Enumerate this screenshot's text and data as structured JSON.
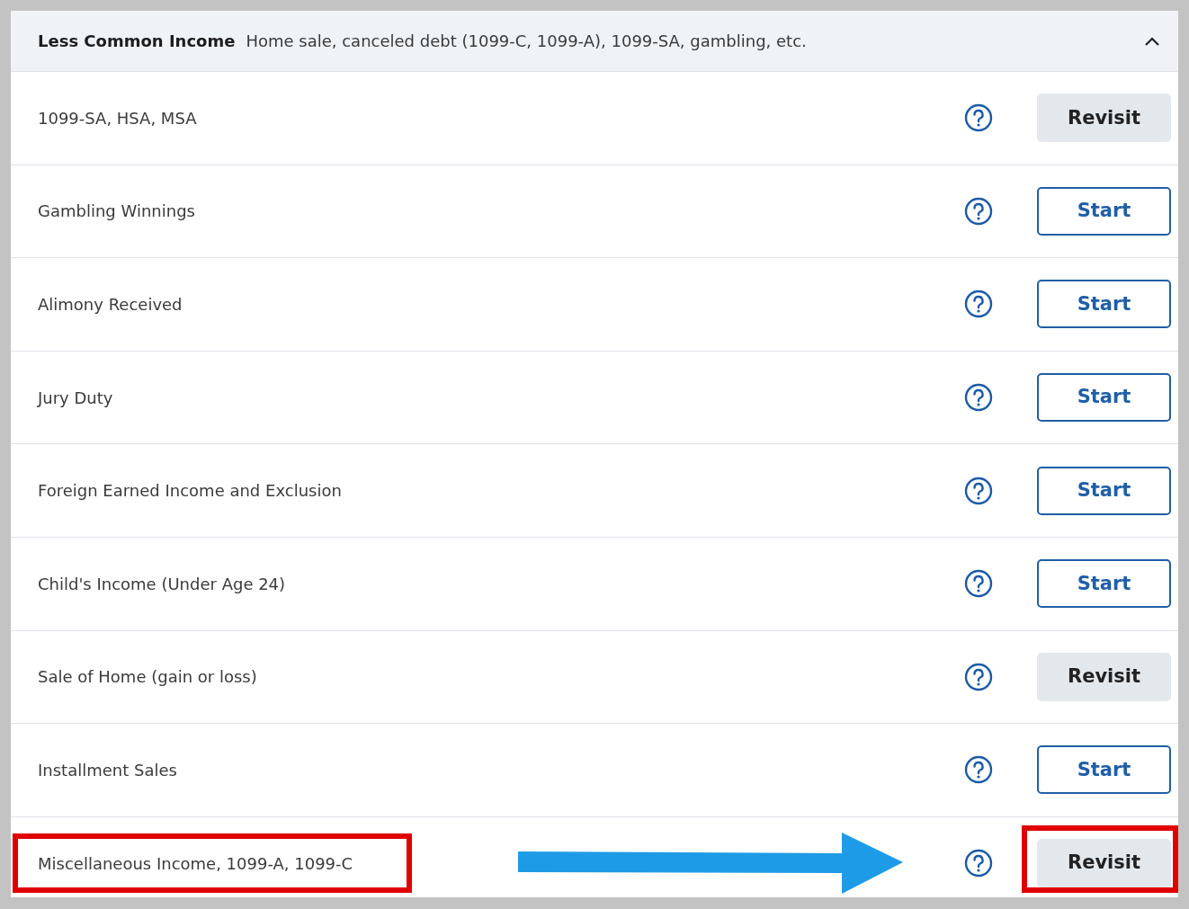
{
  "section": {
    "title": "Less Common Income",
    "subtitle": "Home sale, canceled debt (1099-C, 1099-A), 1099-SA, gambling, etc.",
    "expanded": true
  },
  "rows": [
    {
      "label": "1099-SA, HSA, MSA",
      "button": {
        "kind": "revisit",
        "label": "Revisit"
      },
      "highlighted": false
    },
    {
      "label": "Gambling Winnings",
      "button": {
        "kind": "start",
        "label": "Start"
      },
      "highlighted": false
    },
    {
      "label": "Alimony Received",
      "button": {
        "kind": "start",
        "label": "Start"
      },
      "highlighted": false
    },
    {
      "label": "Jury Duty",
      "button": {
        "kind": "start",
        "label": "Start"
      },
      "highlighted": false
    },
    {
      "label": "Foreign Earned Income and Exclusion",
      "button": {
        "kind": "start",
        "label": "Start"
      },
      "highlighted": false
    },
    {
      "label": "Child's Income (Under Age 24)",
      "button": {
        "kind": "start",
        "label": "Start"
      },
      "highlighted": false
    },
    {
      "label": "Sale of Home (gain or loss)",
      "button": {
        "kind": "revisit",
        "label": "Revisit"
      },
      "highlighted": false
    },
    {
      "label": "Installment Sales",
      "button": {
        "kind": "start",
        "label": "Start"
      },
      "highlighted": false
    },
    {
      "label": "Miscellaneous Income, 1099-A, 1099-C",
      "button": {
        "kind": "revisit",
        "label": "Revisit"
      },
      "highlighted": true
    }
  ]
}
